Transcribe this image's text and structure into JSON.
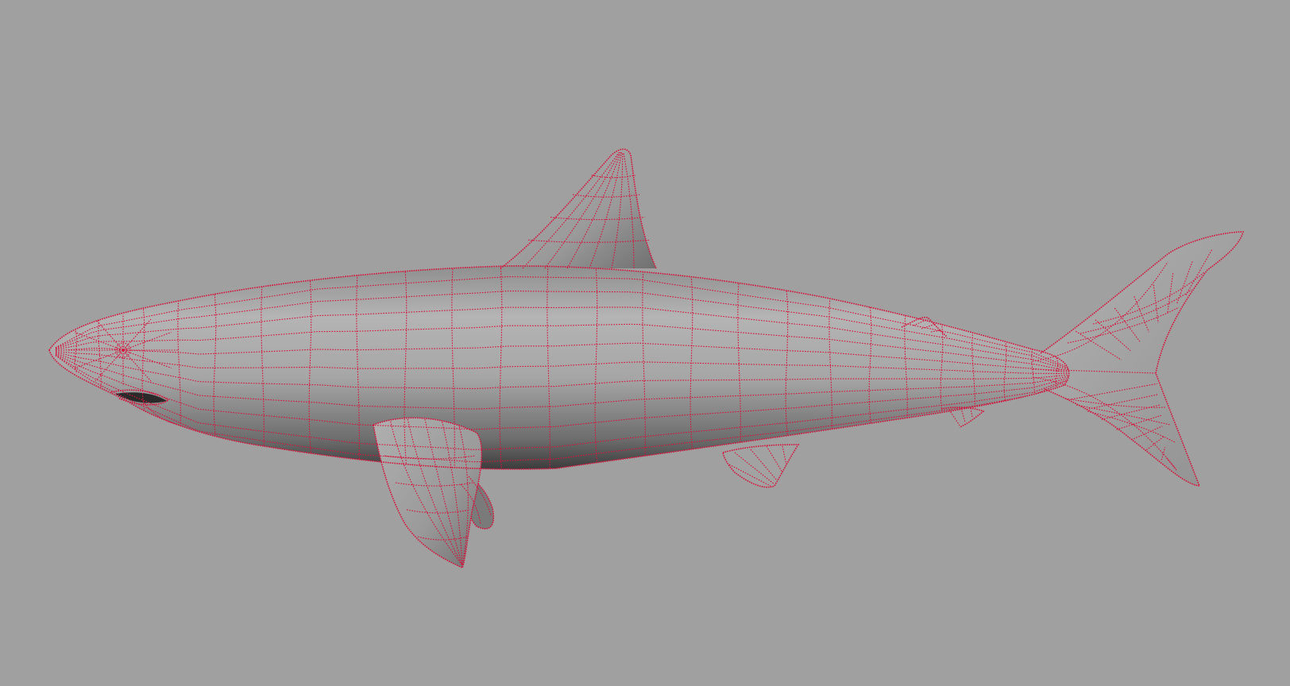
{
  "viewport": {
    "background_color": "#a0a0a0",
    "wireframe_color": "#d4143c",
    "shading": "smooth-shaded-with-wireframe-on-shaded",
    "object": "shark-mesh"
  }
}
